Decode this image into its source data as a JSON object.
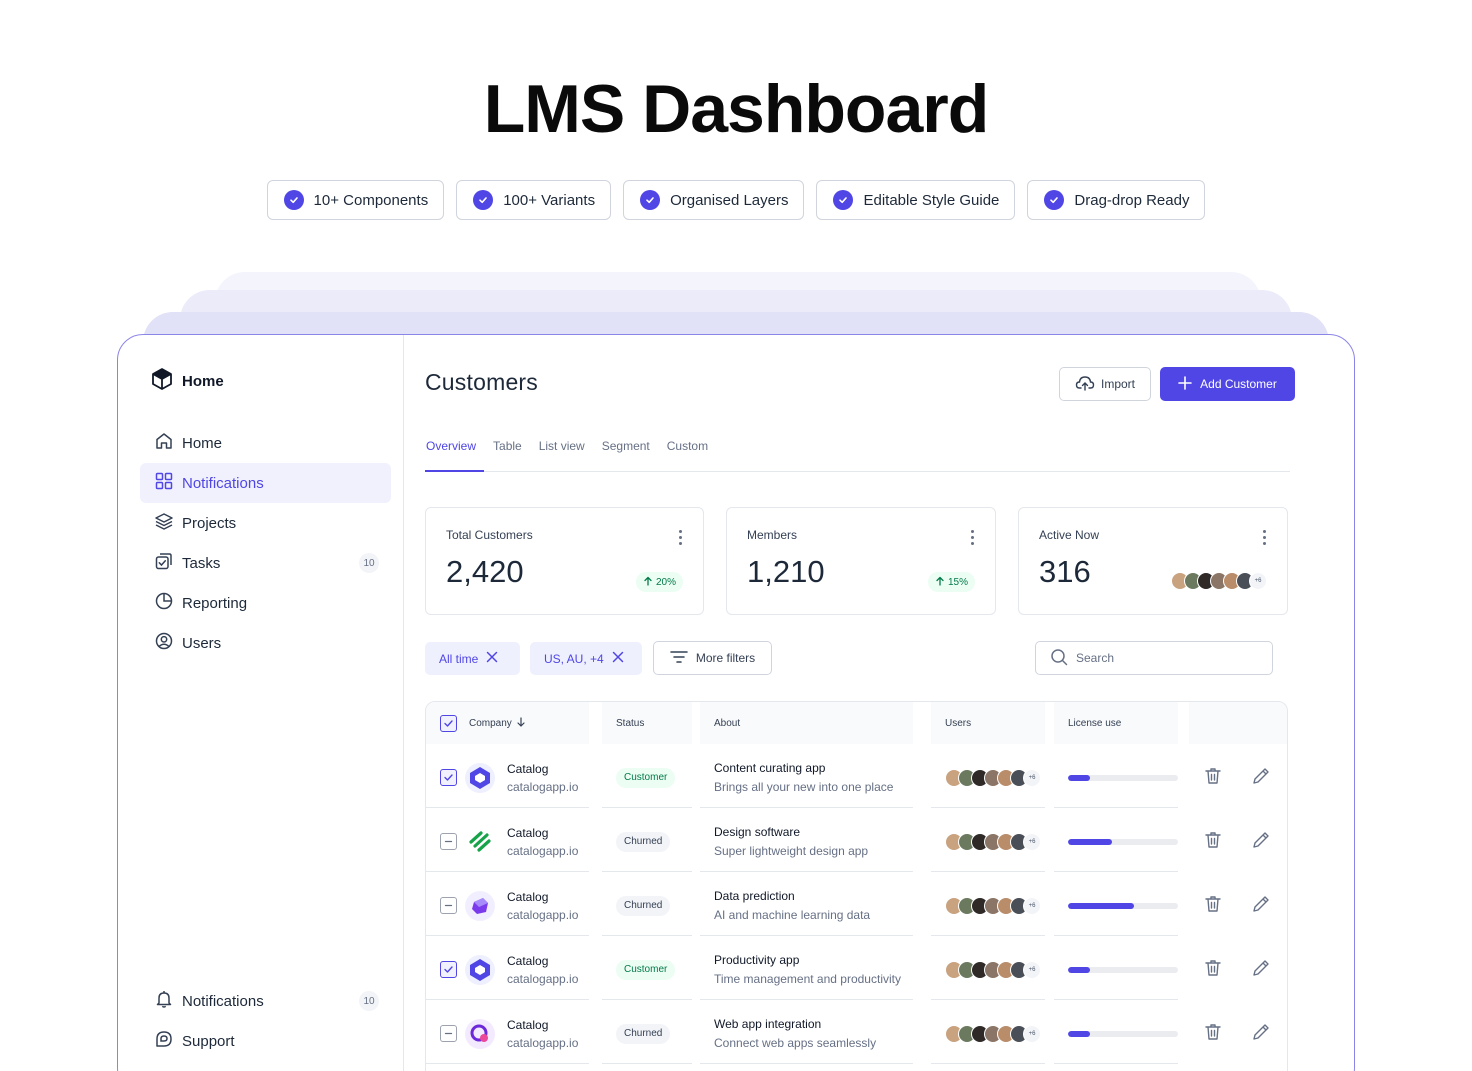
{
  "hero": {
    "title": "LMS Dashboard",
    "features": [
      "10+ Components",
      "100+ Variants",
      "Organised Layers",
      "Editable Style Guide",
      "Drag-drop Ready"
    ]
  },
  "colors": {
    "accent": "#4f46e5",
    "success": "#027a48",
    "success_bg": "#ecfdf3"
  },
  "sidebar": {
    "brand": "Home",
    "items": [
      {
        "label": "Home",
        "icon": "home-icon"
      },
      {
        "label": "Notifications",
        "icon": "grid-icon",
        "active": true
      },
      {
        "label": "Projects",
        "icon": "layers-icon"
      },
      {
        "label": "Tasks",
        "icon": "tasks-icon",
        "badge": "10"
      },
      {
        "label": "Reporting",
        "icon": "pie-chart-icon"
      },
      {
        "label": "Users",
        "icon": "user-circle-icon"
      }
    ],
    "bottom": [
      {
        "label": "Notifications",
        "icon": "bell-icon",
        "badge": "10"
      },
      {
        "label": "Support",
        "icon": "support-icon"
      }
    ]
  },
  "header": {
    "title": "Customers",
    "import_label": "Import",
    "add_label": "Add Customer"
  },
  "tabs": [
    "Overview",
    "Table",
    "List view",
    "Segment",
    "Custom"
  ],
  "stats": [
    {
      "label": "Total Customers",
      "value": "2,420",
      "trend": "20%"
    },
    {
      "label": "Members",
      "value": "1,210",
      "trend": "15%"
    },
    {
      "label": "Active Now",
      "value": "316",
      "avatars_more": "+6"
    }
  ],
  "filters": {
    "chips": [
      "All time",
      "US, AU, +4"
    ],
    "more_label": "More filters",
    "search_placeholder": "Search"
  },
  "table": {
    "headers": [
      "Company",
      "Status",
      "About",
      "Users",
      "License use"
    ],
    "users_more": "+6",
    "rows": [
      {
        "checked": true,
        "name": "Catalog",
        "url": "catalogapp.io",
        "status": "Customer",
        "about_title": "Content curating app",
        "about_sub": "Brings all your new into one place",
        "license": 0.2,
        "logo": "catalog"
      },
      {
        "checked": false,
        "name": "Catalog",
        "url": "catalogapp.io",
        "status": "Churned",
        "about_title": "Design software",
        "about_sub": "Super lightweight design app",
        "license": 0.4,
        "logo": "stripes"
      },
      {
        "checked": false,
        "name": "Catalog",
        "url": "catalogapp.io",
        "status": "Churned",
        "about_title": "Data prediction",
        "about_sub": "AI and machine learning data",
        "license": 0.6,
        "logo": "cube"
      },
      {
        "checked": true,
        "name": "Catalog",
        "url": "catalogapp.io",
        "status": "Customer",
        "about_title": "Productivity app",
        "about_sub": "Time management and productivity",
        "license": 0.2,
        "logo": "catalog"
      },
      {
        "checked": false,
        "name": "Catalog",
        "url": "catalogapp.io",
        "status": "Churned",
        "about_title": "Web app integration",
        "about_sub": "Connect web apps seamlessly",
        "license": 0.2,
        "logo": "q"
      }
    ]
  }
}
